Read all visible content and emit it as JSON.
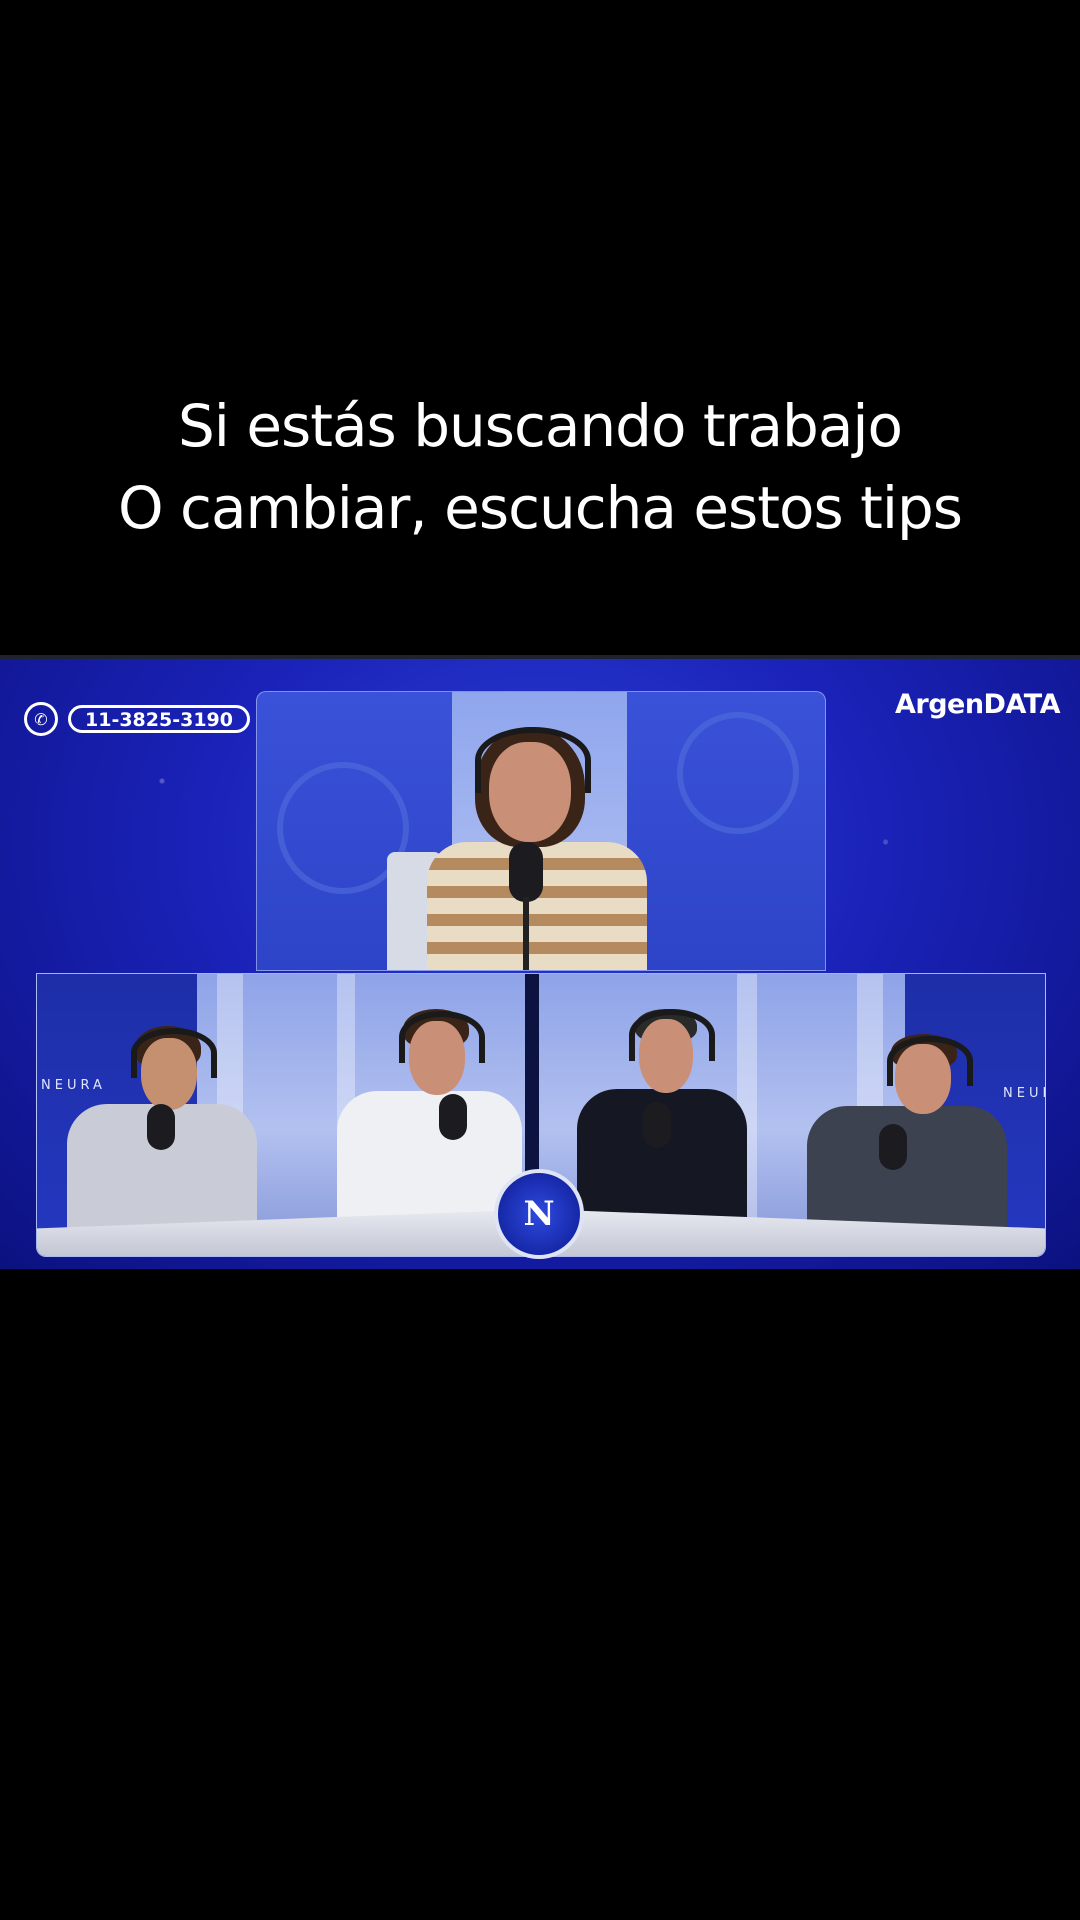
{
  "caption": {
    "line1": "Si estás buscando trabajo",
    "line2": "O cambiar, escucha estos tips"
  },
  "video": {
    "phone": "11-3825-3190",
    "phone_icon": "whatsapp-icon",
    "brand": "ArgenDATA",
    "studio_logo_text": "NEURA",
    "center_logo_glyph": "N",
    "colors": {
      "background": "#000000",
      "studio_blue": "#1a22b8",
      "text": "#ffffff"
    }
  }
}
